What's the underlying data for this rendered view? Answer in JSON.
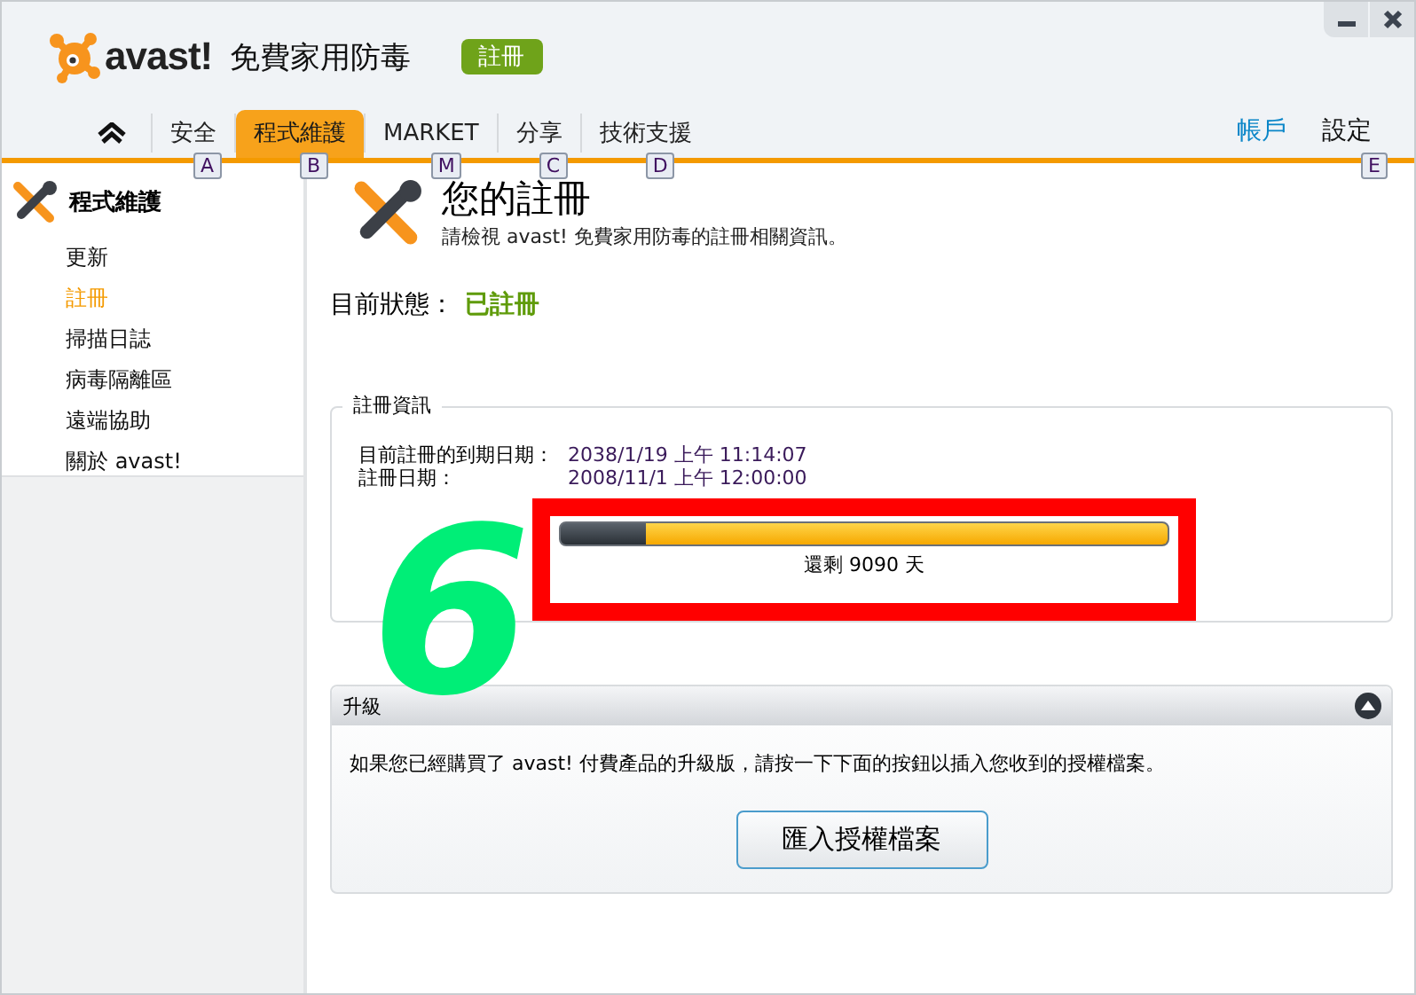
{
  "window": {
    "buttons": [
      {
        "kind": "minimize"
      },
      {
        "kind": "close"
      }
    ]
  },
  "header": {
    "logo_text": "avast!",
    "product": "免費家用防毒",
    "badge": "註冊"
  },
  "tabs": [
    {
      "kind": "home",
      "selected": false
    },
    {
      "kind": "text",
      "label": "安全",
      "key": "A",
      "selected": false
    },
    {
      "kind": "text",
      "label": "程式維護",
      "key": "B",
      "selected": true
    },
    {
      "kind": "text",
      "label": "MARKET",
      "key": "M",
      "selected": false
    },
    {
      "kind": "text",
      "label": "分享",
      "key": "C",
      "selected": false
    },
    {
      "kind": "text",
      "label": "技術支援",
      "key": "D",
      "selected": false
    }
  ],
  "right_links": [
    {
      "label": "帳戶",
      "kind": "link"
    },
    {
      "label": "設定",
      "kind": "plain",
      "key": "E"
    }
  ],
  "sidebar": {
    "title": "程式維護",
    "items": [
      {
        "label": "更新",
        "selected": false
      },
      {
        "label": "註冊",
        "selected": true
      },
      {
        "label": "掃描日誌",
        "selected": false
      },
      {
        "label": "病毒隔離區",
        "selected": false
      },
      {
        "label": "遠端協助",
        "selected": false
      },
      {
        "label": "關於 avast!",
        "selected": false
      }
    ]
  },
  "page": {
    "title": "您的註冊",
    "subtitle": "請檢視 avast! 免費家用防毒的註冊相關資訊。",
    "status_label": "目前狀態：",
    "status_value": "已註冊"
  },
  "registration_info": {
    "legend": "註冊資訊",
    "rows": [
      {
        "label": "目前註冊的到期日期：",
        "value": "2038/1/19 上午 11:14:07"
      },
      {
        "label": "註冊日期：",
        "value": "2008/11/1 上午 12:00:00"
      }
    ],
    "remaining": {
      "level": 0.86,
      "reading": "還剩 9090 天"
    }
  },
  "upgrade": {
    "title": "升級",
    "expanded": true,
    "text": "如果您已經購買了 avast! 付費產品的升級版，請按一下下面的按鈕以插入您收到的授權檔案。",
    "button": "匯入授權檔案"
  },
  "annotation": {
    "number": "6"
  }
}
